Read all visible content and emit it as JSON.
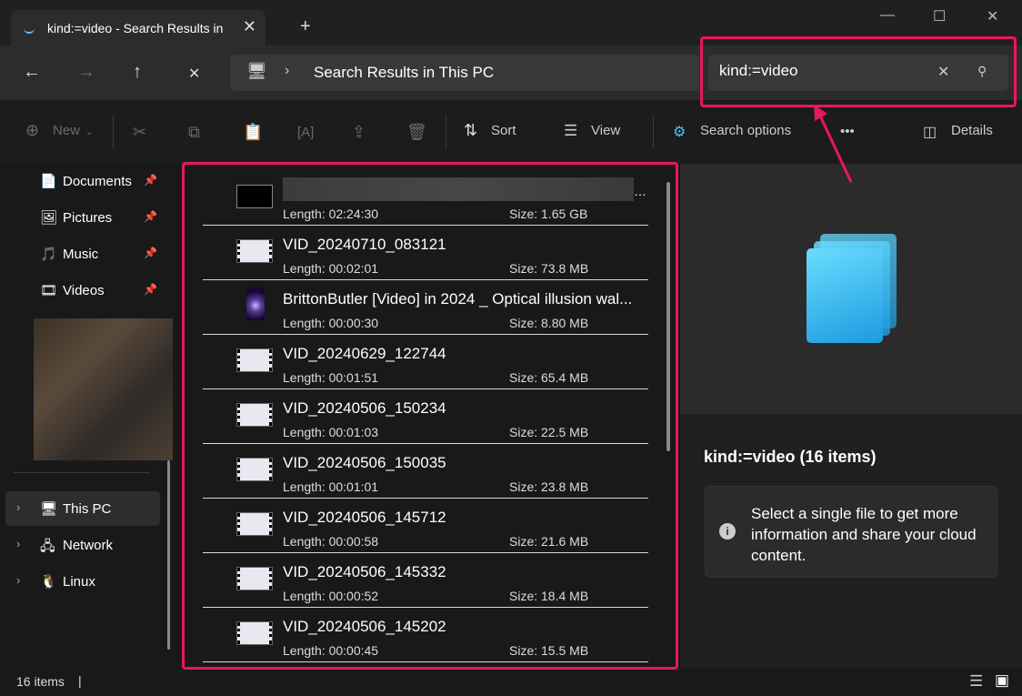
{
  "tab": {
    "title": "kind:=video - Search Results in",
    "close": "✕",
    "new": "+"
  },
  "window": {
    "minimize": "—",
    "maximize": "☐",
    "close": "✕"
  },
  "nav": {
    "back": "←",
    "forward": "→",
    "up": "↑",
    "stop": "✕"
  },
  "address": {
    "icon": "pc-icon",
    "separator": "›",
    "path": "Search Results in This PC"
  },
  "search": {
    "value": "kind:=video",
    "clear": "✕",
    "search_icon": "🔍"
  },
  "toolbar": {
    "new": "New",
    "sort": "Sort",
    "view": "View",
    "search_options": "Search options",
    "more": "•••",
    "details": "Details"
  },
  "sidebar": {
    "quick": [
      {
        "label": "Documents",
        "icon": "documents-icon"
      },
      {
        "label": "Pictures",
        "icon": "pictures-icon"
      },
      {
        "label": "Music",
        "icon": "music-icon"
      },
      {
        "label": "Videos",
        "icon": "videos-icon"
      }
    ],
    "tree": [
      {
        "label": "This PC",
        "icon": "pc-icon"
      },
      {
        "label": "Network",
        "icon": "network-icon"
      },
      {
        "label": "Linux",
        "icon": "linux-icon"
      }
    ]
  },
  "files": [
    {
      "name": "",
      "length": "Length: 02:24:30",
      "size": "Size: 1.65 GB",
      "thumb": "dark"
    },
    {
      "name": "VID_20240710_083121",
      "length": "Length: 00:02:01",
      "size": "Size: 73.8 MB",
      "thumb": "light"
    },
    {
      "name": "BrittonButler [Video] in 2024 _ Optical illusion wal...",
      "length": "Length: 00:00:30",
      "size": "Size: 8.80 MB",
      "thumb": "tall"
    },
    {
      "name": "VID_20240629_122744",
      "length": "Length: 00:01:51",
      "size": "Size: 65.4 MB",
      "thumb": "light"
    },
    {
      "name": "VID_20240506_150234",
      "length": "Length: 00:01:03",
      "size": "Size: 22.5 MB",
      "thumb": "light"
    },
    {
      "name": "VID_20240506_150035",
      "length": "Length: 00:01:01",
      "size": "Size: 23.8 MB",
      "thumb": "light"
    },
    {
      "name": "VID_20240506_145712",
      "length": "Length: 00:00:58",
      "size": "Size: 21.6 MB",
      "thumb": "light"
    },
    {
      "name": "VID_20240506_145332",
      "length": "Length: 00:00:52",
      "size": "Size: 18.4 MB",
      "thumb": "light"
    },
    {
      "name": "VID_20240506_145202",
      "length": "Length: 00:00:45",
      "size": "Size: 15.5 MB",
      "thumb": "light"
    }
  ],
  "details": {
    "title": "kind:=video (16 items)",
    "info": "Select a single file to get more information and share your cloud content."
  },
  "status": {
    "count": "16 items"
  },
  "colors": {
    "highlight": "#e8175d",
    "accent": "#4cc2ff"
  }
}
